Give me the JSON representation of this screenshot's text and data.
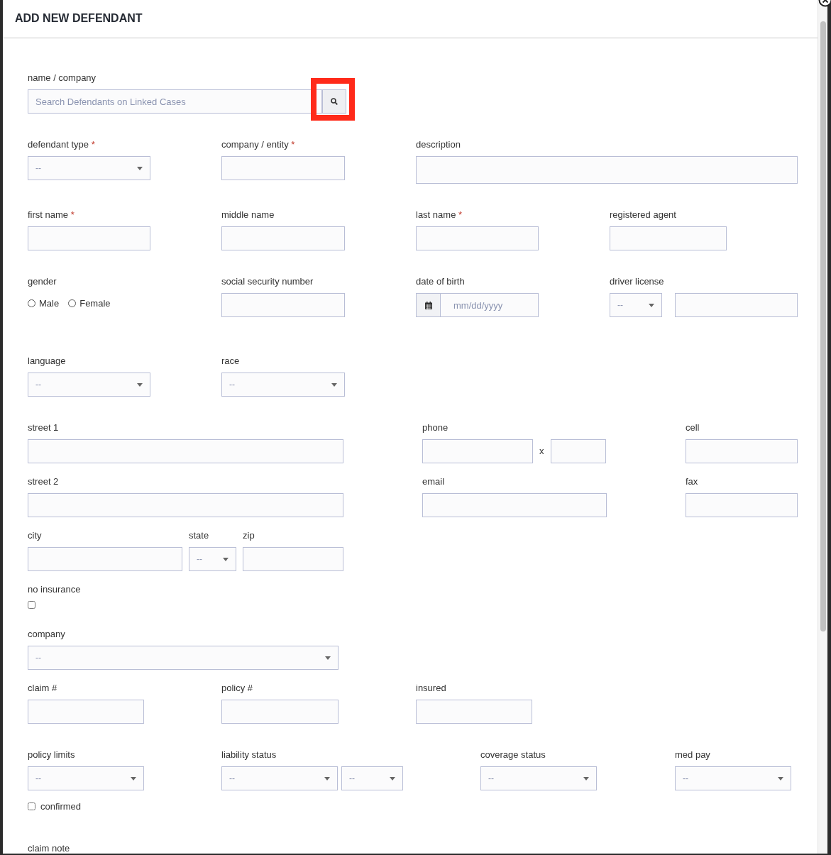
{
  "dialog": {
    "title": "ADD NEW DEFENDANT"
  },
  "rows": [
    [
      {
        "kind": "search",
        "label": "name / company",
        "placeholder": "Search Defendants on Linked Cases",
        "button_highlighted": true
      }
    ],
    [
      {
        "kind": "select",
        "label": "defendant type",
        "marker": "*",
        "value": "--"
      },
      {
        "kind": "text",
        "label": "company / entity",
        "marker": "*"
      },
      {
        "kind": "textarea",
        "label": "description"
      }
    ],
    [
      {
        "kind": "text",
        "label": "first name",
        "marker": "*"
      },
      {
        "kind": "text",
        "label": "middle name"
      },
      {
        "kind": "text",
        "label": "last name",
        "marker": "*"
      },
      {
        "kind": "text",
        "label": "registered agent"
      }
    ],
    [
      {
        "kind": "radio",
        "label": "gender",
        "options": [
          {
            "label": "Male",
            "selected": false
          },
          {
            "label": "Female",
            "selected": false
          }
        ]
      },
      {
        "kind": "text",
        "label": "social security number"
      },
      {
        "kind": "date",
        "label": "date of birth",
        "placeholder": "mm/dd/yyyy"
      },
      {
        "kind": "select_text",
        "label": "driver license",
        "value": "--"
      }
    ],
    [
      {
        "kind": "select",
        "label": "language",
        "value": "--"
      },
      {
        "kind": "select",
        "label": "race",
        "value": "--"
      }
    ],
    [
      {
        "kind": "text",
        "label": "street 1"
      },
      {
        "kind": "phone",
        "label": "phone",
        "separator": "x"
      },
      {
        "kind": "text",
        "label": "cell"
      }
    ],
    [
      {
        "kind": "text",
        "label": "street 2"
      },
      {
        "kind": "text",
        "label": "email"
      },
      {
        "kind": "text",
        "label": "fax"
      }
    ],
    [
      {
        "kind": "text",
        "label": "city"
      },
      {
        "kind": "select",
        "label": "state",
        "value": "--"
      },
      {
        "kind": "text",
        "label": "zip"
      }
    ],
    [
      {
        "kind": "checkbox",
        "label": "no insurance",
        "checked": false
      }
    ],
    [
      {
        "kind": "select",
        "label": "company",
        "value": "--"
      }
    ],
    [
      {
        "kind": "text",
        "label": "claim #"
      },
      {
        "kind": "text",
        "label": "policy #"
      },
      {
        "kind": "text",
        "label": "insured"
      }
    ],
    [
      {
        "kind": "select",
        "label": "policy limits",
        "value": "--",
        "confirm": {
          "label": "confirmed",
          "checked": false
        }
      },
      {
        "kind": "select_pair",
        "label": "liability status",
        "values": [
          "--",
          "--"
        ]
      },
      {
        "kind": "select",
        "label": "coverage status",
        "value": "--"
      },
      {
        "kind": "select",
        "label": "med pay",
        "value": "--"
      }
    ],
    [
      {
        "kind": "label",
        "label": "claim note"
      }
    ]
  ]
}
